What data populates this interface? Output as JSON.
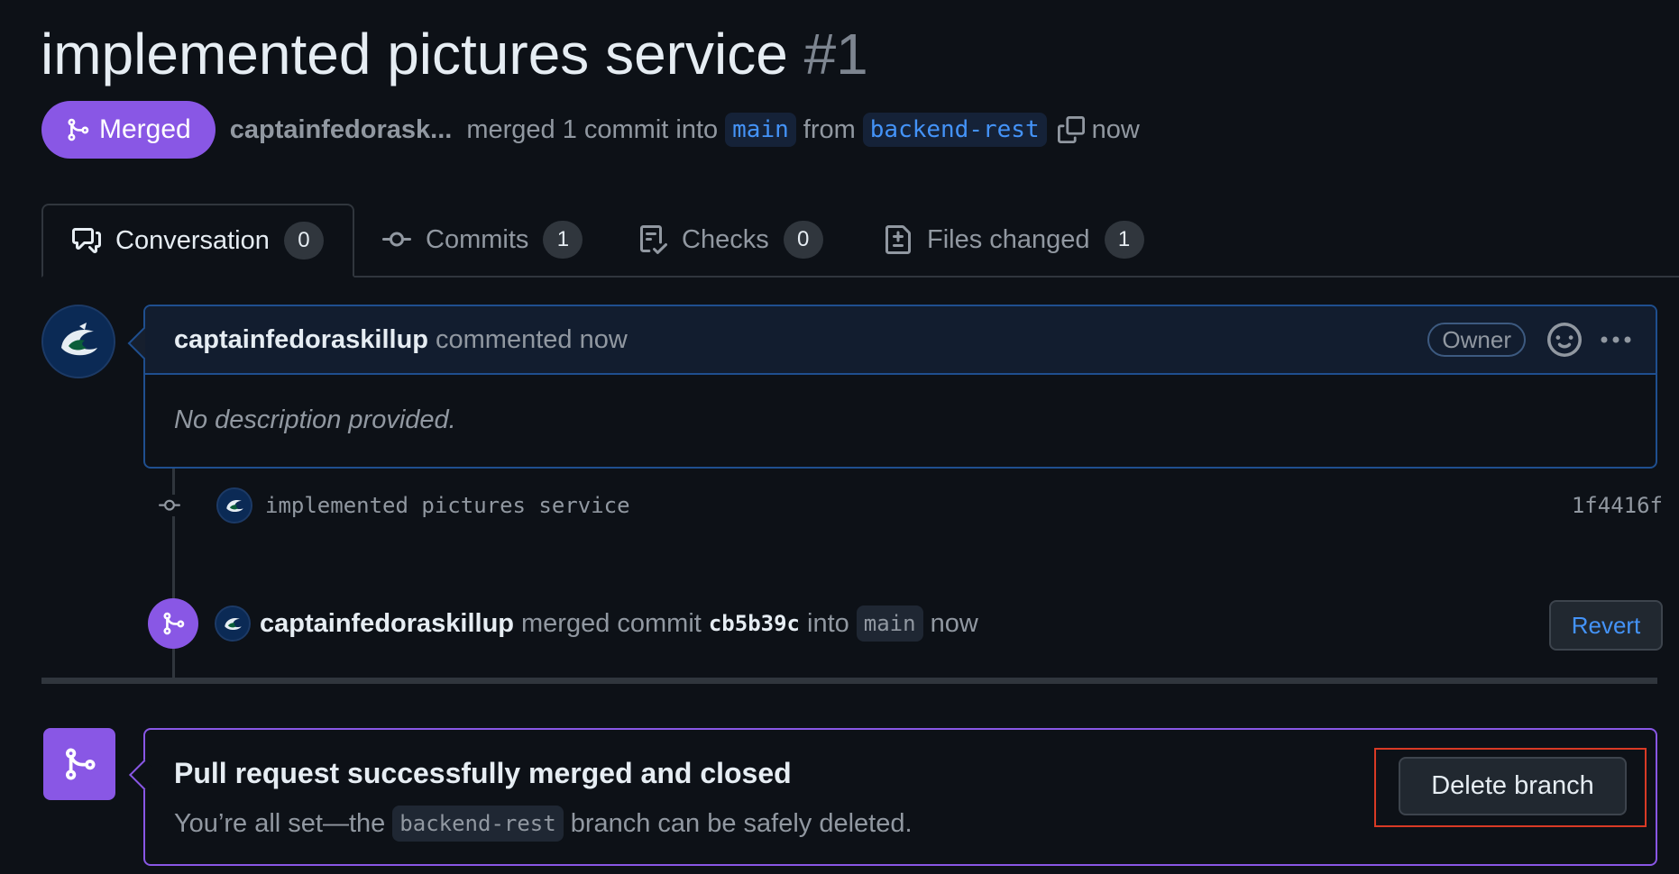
{
  "title": {
    "text": "implemented pictures service",
    "number": "#1"
  },
  "state": {
    "badge": "Merged",
    "author": "captainfedorask...",
    "text_merged": "merged 1 commit into",
    "base_branch": "main",
    "text_from": "from",
    "head_branch": "backend-rest",
    "time": "now"
  },
  "tabs": [
    {
      "label": "Conversation",
      "count": "0",
      "icon": "comment-discussion-icon"
    },
    {
      "label": "Commits",
      "count": "1",
      "icon": "git-commit-icon"
    },
    {
      "label": "Checks",
      "count": "0",
      "icon": "checklist-icon"
    },
    {
      "label": "Files changed",
      "count": "1",
      "icon": "file-diff-icon"
    }
  ],
  "comment": {
    "author": "captainfedoraskillup",
    "action": "commented now",
    "role": "Owner",
    "body": "No description provided."
  },
  "commit": {
    "message": "implemented pictures service",
    "sha": "1f4416f"
  },
  "merge_event": {
    "author": "captainfedoraskillup",
    "text1": "merged commit",
    "sha": "cb5b39c",
    "text2": "into",
    "branch": "main",
    "time": "now",
    "revert_label": "Revert"
  },
  "merged_box": {
    "title": "Pull request successfully merged and closed",
    "text_before": "You’re all set—the",
    "branch": "backend-rest",
    "text_after": "branch can be safely deleted.",
    "delete_label": "Delete branch"
  },
  "colors": {
    "merged": "#8957e5",
    "link": "#4493f8",
    "bg": "#0d1117",
    "highlight": "#d93a25"
  }
}
